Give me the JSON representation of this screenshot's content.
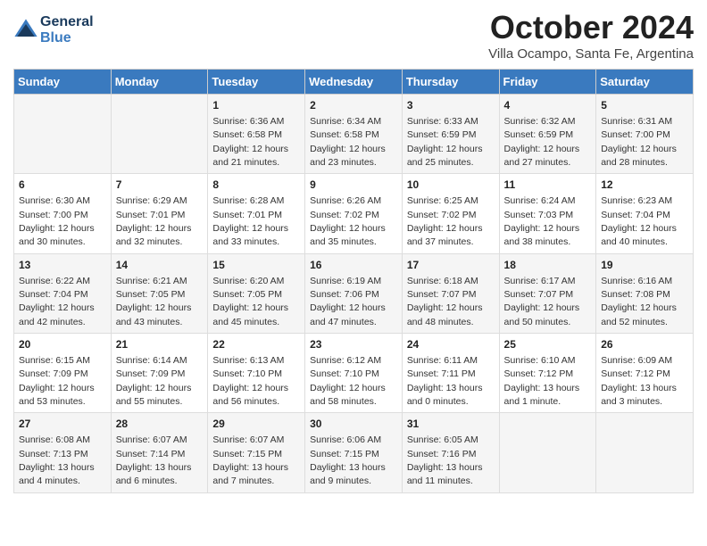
{
  "header": {
    "logo_line1": "General",
    "logo_line2": "Blue",
    "month_title": "October 2024",
    "subtitle": "Villa Ocampo, Santa Fe, Argentina"
  },
  "days_of_week": [
    "Sunday",
    "Monday",
    "Tuesday",
    "Wednesday",
    "Thursday",
    "Friday",
    "Saturday"
  ],
  "weeks": [
    [
      {
        "day": "",
        "info": ""
      },
      {
        "day": "",
        "info": ""
      },
      {
        "day": "1",
        "info": "Sunrise: 6:36 AM\nSunset: 6:58 PM\nDaylight: 12 hours and 21 minutes."
      },
      {
        "day": "2",
        "info": "Sunrise: 6:34 AM\nSunset: 6:58 PM\nDaylight: 12 hours and 23 minutes."
      },
      {
        "day": "3",
        "info": "Sunrise: 6:33 AM\nSunset: 6:59 PM\nDaylight: 12 hours and 25 minutes."
      },
      {
        "day": "4",
        "info": "Sunrise: 6:32 AM\nSunset: 6:59 PM\nDaylight: 12 hours and 27 minutes."
      },
      {
        "day": "5",
        "info": "Sunrise: 6:31 AM\nSunset: 7:00 PM\nDaylight: 12 hours and 28 minutes."
      }
    ],
    [
      {
        "day": "6",
        "info": "Sunrise: 6:30 AM\nSunset: 7:00 PM\nDaylight: 12 hours and 30 minutes."
      },
      {
        "day": "7",
        "info": "Sunrise: 6:29 AM\nSunset: 7:01 PM\nDaylight: 12 hours and 32 minutes."
      },
      {
        "day": "8",
        "info": "Sunrise: 6:28 AM\nSunset: 7:01 PM\nDaylight: 12 hours and 33 minutes."
      },
      {
        "day": "9",
        "info": "Sunrise: 6:26 AM\nSunset: 7:02 PM\nDaylight: 12 hours and 35 minutes."
      },
      {
        "day": "10",
        "info": "Sunrise: 6:25 AM\nSunset: 7:02 PM\nDaylight: 12 hours and 37 minutes."
      },
      {
        "day": "11",
        "info": "Sunrise: 6:24 AM\nSunset: 7:03 PM\nDaylight: 12 hours and 38 minutes."
      },
      {
        "day": "12",
        "info": "Sunrise: 6:23 AM\nSunset: 7:04 PM\nDaylight: 12 hours and 40 minutes."
      }
    ],
    [
      {
        "day": "13",
        "info": "Sunrise: 6:22 AM\nSunset: 7:04 PM\nDaylight: 12 hours and 42 minutes."
      },
      {
        "day": "14",
        "info": "Sunrise: 6:21 AM\nSunset: 7:05 PM\nDaylight: 12 hours and 43 minutes."
      },
      {
        "day": "15",
        "info": "Sunrise: 6:20 AM\nSunset: 7:05 PM\nDaylight: 12 hours and 45 minutes."
      },
      {
        "day": "16",
        "info": "Sunrise: 6:19 AM\nSunset: 7:06 PM\nDaylight: 12 hours and 47 minutes."
      },
      {
        "day": "17",
        "info": "Sunrise: 6:18 AM\nSunset: 7:07 PM\nDaylight: 12 hours and 48 minutes."
      },
      {
        "day": "18",
        "info": "Sunrise: 6:17 AM\nSunset: 7:07 PM\nDaylight: 12 hours and 50 minutes."
      },
      {
        "day": "19",
        "info": "Sunrise: 6:16 AM\nSunset: 7:08 PM\nDaylight: 12 hours and 52 minutes."
      }
    ],
    [
      {
        "day": "20",
        "info": "Sunrise: 6:15 AM\nSunset: 7:09 PM\nDaylight: 12 hours and 53 minutes."
      },
      {
        "day": "21",
        "info": "Sunrise: 6:14 AM\nSunset: 7:09 PM\nDaylight: 12 hours and 55 minutes."
      },
      {
        "day": "22",
        "info": "Sunrise: 6:13 AM\nSunset: 7:10 PM\nDaylight: 12 hours and 56 minutes."
      },
      {
        "day": "23",
        "info": "Sunrise: 6:12 AM\nSunset: 7:10 PM\nDaylight: 12 hours and 58 minutes."
      },
      {
        "day": "24",
        "info": "Sunrise: 6:11 AM\nSunset: 7:11 PM\nDaylight: 13 hours and 0 minutes."
      },
      {
        "day": "25",
        "info": "Sunrise: 6:10 AM\nSunset: 7:12 PM\nDaylight: 13 hours and 1 minute."
      },
      {
        "day": "26",
        "info": "Sunrise: 6:09 AM\nSunset: 7:12 PM\nDaylight: 13 hours and 3 minutes."
      }
    ],
    [
      {
        "day": "27",
        "info": "Sunrise: 6:08 AM\nSunset: 7:13 PM\nDaylight: 13 hours and 4 minutes."
      },
      {
        "day": "28",
        "info": "Sunrise: 6:07 AM\nSunset: 7:14 PM\nDaylight: 13 hours and 6 minutes."
      },
      {
        "day": "29",
        "info": "Sunrise: 6:07 AM\nSunset: 7:15 PM\nDaylight: 13 hours and 7 minutes."
      },
      {
        "day": "30",
        "info": "Sunrise: 6:06 AM\nSunset: 7:15 PM\nDaylight: 13 hours and 9 minutes."
      },
      {
        "day": "31",
        "info": "Sunrise: 6:05 AM\nSunset: 7:16 PM\nDaylight: 13 hours and 11 minutes."
      },
      {
        "day": "",
        "info": ""
      },
      {
        "day": "",
        "info": ""
      }
    ]
  ]
}
